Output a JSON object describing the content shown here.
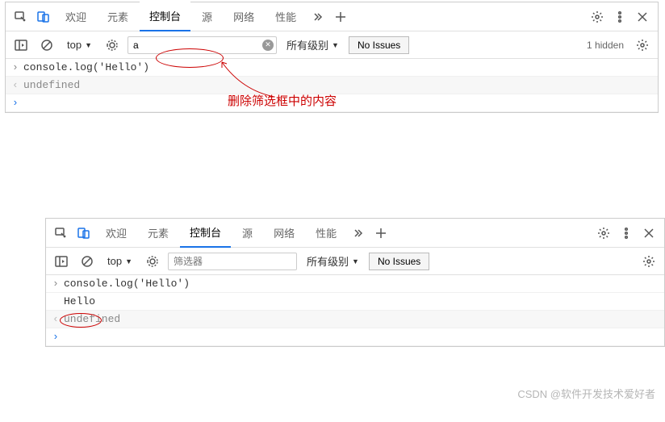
{
  "top": {
    "tabs": [
      "欢迎",
      "元素",
      "控制台",
      "源",
      "网络",
      "性能"
    ],
    "activeIdx": 2,
    "context": "top",
    "filterValue": "a",
    "levels": "所有级别",
    "issues": "No Issues",
    "hidden": "1 hidden",
    "console": {
      "input": "console.log('Hello')",
      "ret": "undefined"
    }
  },
  "bottom": {
    "tabs": [
      "欢迎",
      "元素",
      "控制台",
      "源",
      "网络",
      "性能"
    ],
    "activeIdx": 2,
    "context": "top",
    "filterPlaceholder": "筛选器",
    "levels": "所有级别",
    "issues": "No Issues",
    "console": {
      "input": "console.log('Hello')",
      "output": "Hello",
      "ret": "undefined"
    }
  },
  "annotation": "删除筛选框中的内容",
  "watermark": "CSDN @软件开发技术爱好者"
}
